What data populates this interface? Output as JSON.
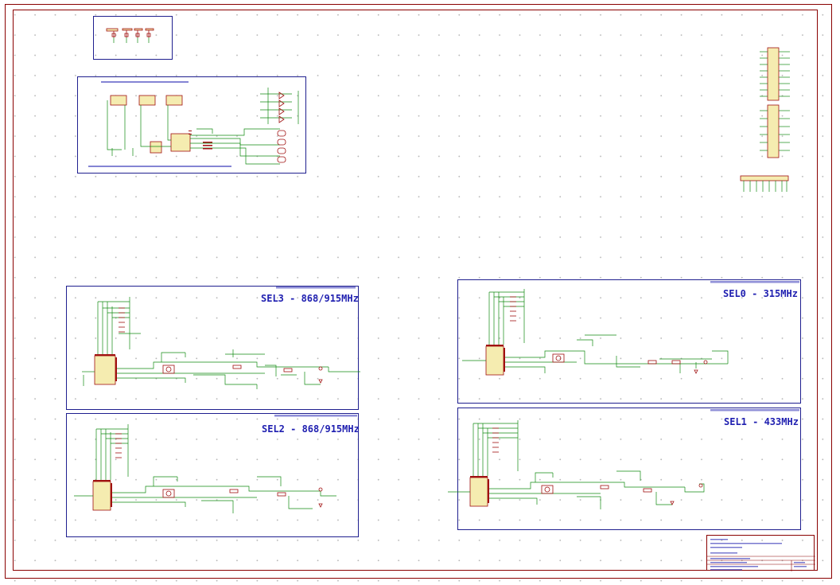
{
  "sections": {
    "sel3": {
      "title": "SEL3 - 868/915MHz"
    },
    "sel2": {
      "title": "SEL2 - 868/915MHz"
    },
    "sel0": {
      "title": "SEL0 - 315MHz"
    },
    "sel1": {
      "title": "SEL1 - 433MHz"
    }
  },
  "colors": {
    "border": "#8a0000",
    "frame": "#1f1f8f",
    "wire": "#118a11",
    "component": "#a01010",
    "text": "#1f1fb0"
  }
}
